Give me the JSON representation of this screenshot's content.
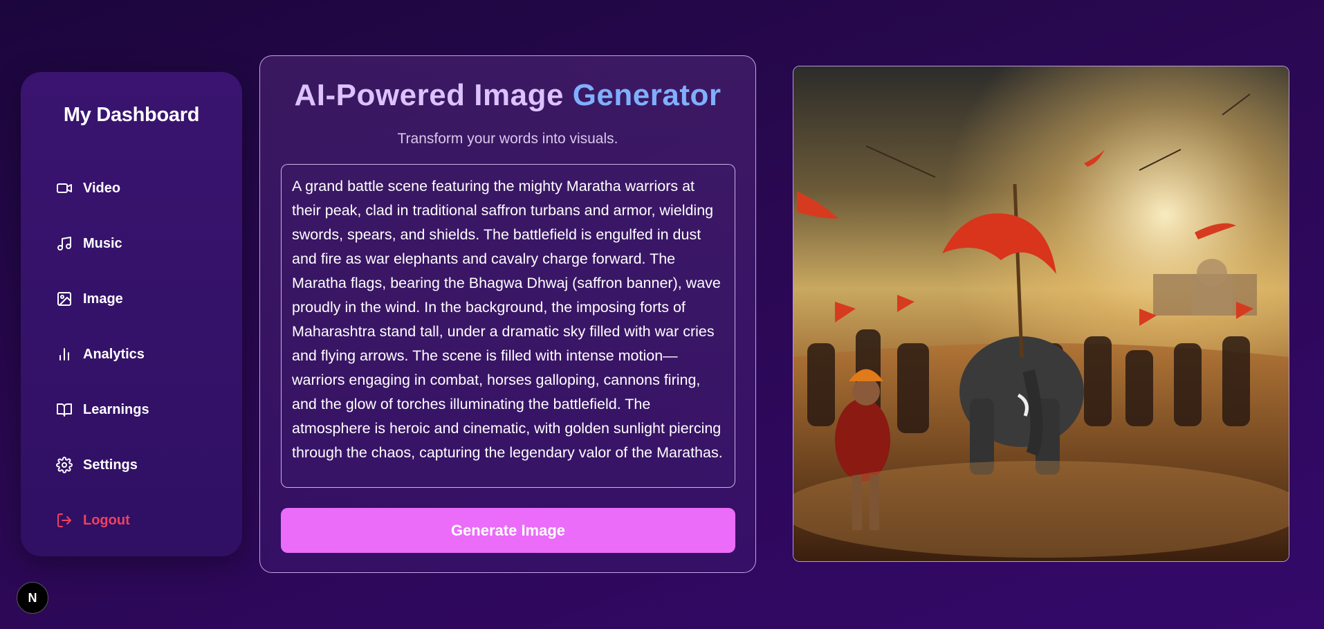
{
  "sidebar": {
    "title": "My Dashboard",
    "items": [
      {
        "label": "Video",
        "icon": "video-icon"
      },
      {
        "label": "Music",
        "icon": "music-icon"
      },
      {
        "label": "Image",
        "icon": "image-icon"
      },
      {
        "label": "Analytics",
        "icon": "bar-chart-icon"
      },
      {
        "label": "Learnings",
        "icon": "book-icon"
      },
      {
        "label": "Settings",
        "icon": "gear-icon"
      },
      {
        "label": "Logout",
        "icon": "logout-icon"
      }
    ]
  },
  "generator": {
    "title_part1": "AI-Powered Image ",
    "title_part2": "Generator",
    "subtitle": "Transform your words into visuals.",
    "prompt": "A grand battle scene featuring the mighty Maratha warriors at their peak, clad in traditional saffron turbans and armor, wielding swords, spears, and shields. The battlefield is engulfed in dust and fire as war elephants and cavalry charge forward. The Maratha flags, bearing the Bhagwa Dhwaj (saffron banner), wave proudly in the wind. In the background, the imposing forts of Maharashtra stand tall, under a dramatic sky filled with war cries and flying arrows. The scene is filled with intense motion—warriors engaging in combat, horses galloping, cannons firing, and the glow of torches illuminating the battlefield. The atmosphere is heroic and cinematic, with golden sunlight piercing through the chaos, capturing the legendary valor of the Marathas.",
    "button_label": "Generate Image"
  },
  "badge": {
    "label": "N"
  },
  "colors": {
    "accent_button": "#ea6cf9",
    "title_gradient_start": "#dcc2ff",
    "title_gradient_end": "#7fb0ff",
    "logout": "#f0415f"
  }
}
